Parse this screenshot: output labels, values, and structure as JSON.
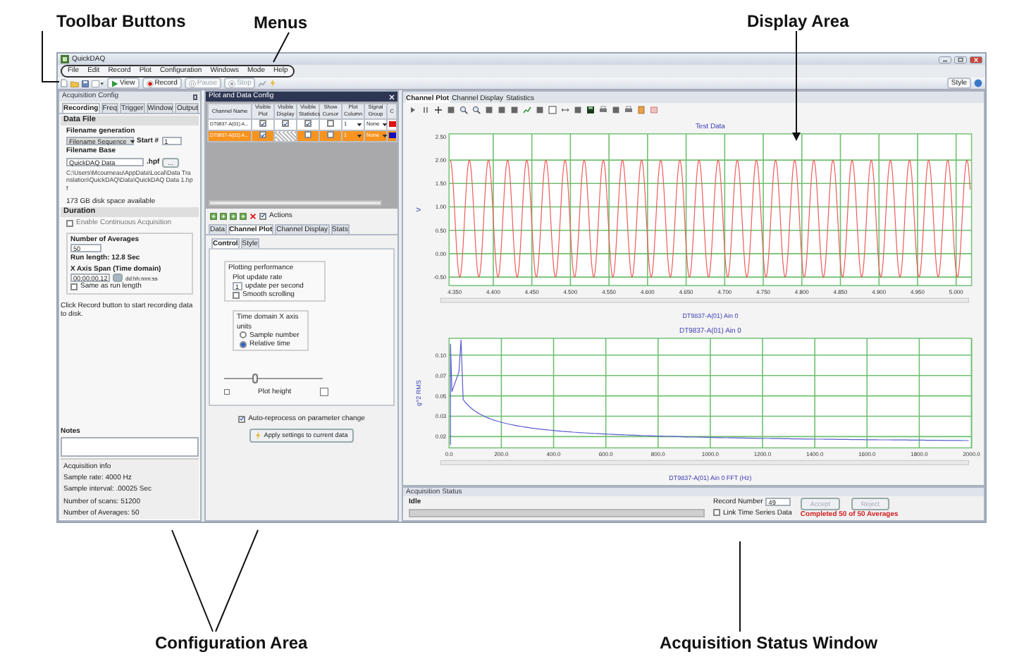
{
  "annotations": [
    {
      "text": "Toolbar Buttons"
    },
    {
      "text": "Menus"
    },
    {
      "text": "Display Area"
    },
    {
      "text": "Configuration Area"
    },
    {
      "text": "Acquisition Status Window"
    }
  ],
  "window": {
    "title": "QuickDAQ"
  },
  "menu": [
    "File",
    "Edit",
    "Record",
    "Plot",
    "Configuration",
    "Windows",
    "Mode",
    "Help"
  ],
  "toolbar": {
    "buttons": [
      {
        "label": "View",
        "kind": "play",
        "disabled": false
      },
      {
        "label": "Record",
        "kind": "record",
        "disabled": false
      },
      {
        "label": "Pause",
        "kind": "pause",
        "disabled": true
      },
      {
        "label": "Stop",
        "kind": "stop",
        "disabled": true
      }
    ],
    "style_label": "Style"
  },
  "acquisition_config": {
    "title": "Acquisition Config",
    "tabs": [
      {
        "label": "Recording",
        "selected": true
      },
      {
        "label": "Freq",
        "selected": false
      },
      {
        "label": "Trigger",
        "selected": false
      },
      {
        "label": "Window",
        "selected": false
      },
      {
        "label": "Output",
        "selected": false
      }
    ],
    "data_file": {
      "heading": "Data File",
      "filename_generation_label": "Filename generation",
      "filename_generation": "Filename Sequence",
      "start_label": "Start #",
      "start": "1",
      "filename_base_label": "Filename Base",
      "filename_base": "QuickDAQ Data",
      "extension": ".hpf",
      "browse": "...",
      "path": "C:\\Users\\Mcourneau\\AppData\\Local\\Data Translation\\QuickDAQ\\Data\\QuickDAQ Data 1.hpf",
      "disk_space": "173 GB disk space available"
    },
    "duration": {
      "heading": "Duration",
      "continuous_label": "Enable Continuous Acquisition",
      "continuous": false,
      "averages_label": "Number of Averages",
      "averages": "50",
      "run_length": "Run length:  12.8 Sec",
      "span_label": "X Axis Span (Time domain)",
      "span": "00:00:00.12",
      "span_unit": "dd:hh:mm:ss",
      "same_label": "Same as run length",
      "same": false
    },
    "hint": "Click Record button to start recording data to disk.",
    "notes_label": "Notes",
    "info": {
      "heading": "Acquisition info",
      "lines": [
        "Sample rate: 4000 Hz",
        "Sample interval: .00025 Sec",
        "Number of scans: 51200",
        "Number of Averages: 50"
      ]
    }
  },
  "plot_config": {
    "title": "Plot and Data Config",
    "columns": [
      "Channel Name",
      "Visible Plot",
      "Visible Display",
      "Visible Statistics",
      "Show Cursor",
      "Plot Column",
      "Signal Group",
      "C"
    ],
    "rows": [
      {
        "name": "DT9837-A(01) A...",
        "visible_plot": true,
        "visible_display": true,
        "display_unavailable": false,
        "visible_statistics": true,
        "show_cursor": false,
        "plot_column": "1",
        "signal_group": "None",
        "color": "#e01010",
        "selected": false
      },
      {
        "name": "DT9837-A(01) A...",
        "visible_plot": true,
        "visible_display": false,
        "display_unavailable": true,
        "visible_statistics": false,
        "show_cursor": false,
        "plot_column": "1",
        "signal_group": "None",
        "color": "#1010c0",
        "selected": true
      }
    ],
    "actions_label": "Actions",
    "actions": true,
    "tabs": [
      {
        "label": "Data",
        "selected": false
      },
      {
        "label": "Channel Plot",
        "selected": true
      },
      {
        "label": "Channel Display",
        "selected": false
      },
      {
        "label": "Stats",
        "selected": false
      }
    ],
    "subtabs": [
      {
        "label": "Control",
        "selected": true
      },
      {
        "label": "Style",
        "selected": false
      }
    ],
    "performance": {
      "heading": "Plotting performance",
      "rate_label": "Plot update rate",
      "rate": "1",
      "rate_unit": "update per second",
      "smooth_label": "Smooth scrolling",
      "smooth": false
    },
    "x_units": {
      "heading": "Time domain X axis units",
      "options": [
        {
          "label": "Sample number",
          "selected": false
        },
        {
          "label": "Relative time",
          "selected": true
        }
      ]
    },
    "plot_height": {
      "label": "Plot height",
      "level": 0.3
    },
    "auto_reprocess_label": "Auto-reprocess on parameter change",
    "auto_reprocess": true,
    "apply": "Apply settings to current data"
  },
  "display": {
    "tabs": [
      {
        "label": "Channel Plot",
        "selected": true
      },
      {
        "label": "Channel Display",
        "selected": false
      },
      {
        "label": "Statistics",
        "selected": false
      }
    ],
    "time_plot": {
      "title": "Test Data",
      "ylabel": "V",
      "xlabel": "DT9837-A(01) Ain 0",
      "yticks": [
        "2.50",
        "2.00",
        "1.50",
        "1.00",
        "0.50",
        "0.00",
        "-0.50"
      ],
      "xticks": [
        "4.350",
        "4.400",
        "4.450",
        "4.500",
        "4.550",
        "4.600",
        "4.650",
        "4.700",
        "4.750",
        "4.800",
        "4.850",
        "4.900",
        "4.950",
        "5.000"
      ]
    },
    "fft_plot": {
      "title": "DT9837-A(01) Ain 0",
      "ylabel": "g^2 RMS",
      "xlabel": "DT9837-A(01) Ain 0 FFT (Hz)",
      "yticks": [
        "0.10",
        "0.07",
        "0.05",
        "0.03",
        "0.02"
      ],
      "xticks": [
        "0.0",
        "200.0",
        "400.0",
        "600.0",
        "800.0",
        "1000.0",
        "1200.0",
        "1400.0",
        "1600.0",
        "1800.0",
        "2000.0"
      ]
    }
  },
  "status": {
    "title": "Acquisition Status",
    "state": "Idle",
    "progress": {
      "level": 0
    },
    "record_label": "Record Number",
    "record": "49",
    "link_label": "Link Time Series Data",
    "link": false,
    "accept": {
      "label": "Accept",
      "disabled": true
    },
    "reject": {
      "label": "Reject",
      "disabled": true
    },
    "message": "Completed 50 of 50 Averages"
  }
}
